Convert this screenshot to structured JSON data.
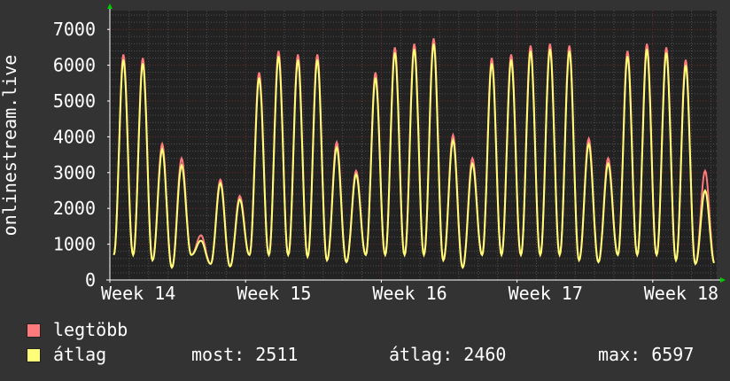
{
  "chart_data": {
    "type": "line",
    "ylabel": "onlinestream.live",
    "xlabel": "",
    "title": "",
    "ylim": [
      0,
      7500
    ],
    "yticks": [
      0,
      1000,
      2000,
      3000,
      4000,
      5000,
      6000,
      7000
    ],
    "xticks": [
      "Week 14",
      "Week 15",
      "Week 16",
      "Week 17",
      "Week 18"
    ],
    "x_range_days": [
      0,
      31.3
    ],
    "grid": true,
    "legend_position": "bottom-left",
    "colors": {
      "background": "#333333",
      "plot_background": "#222222",
      "grid_major": "#6b2c2c",
      "grid_minor": "#505050",
      "axis": "#ffffff",
      "arrow": "#00cc00",
      "max_line": "#ff7b7b",
      "avg_line": "#ffff77"
    },
    "series": [
      {
        "name": "legtöbb",
        "color": "#ff7b7b",
        "daily_peaks": [
          6300,
          6200,
          3800,
          3400,
          1250,
          2800,
          2350,
          5800,
          6400,
          6300,
          6300,
          3850,
          3050,
          5800,
          6500,
          6600,
          6750,
          4050,
          3400,
          6200,
          6300,
          6550,
          6600,
          6550,
          3950,
          3400,
          6400,
          6600,
          6500,
          6150,
          3050
        ],
        "daily_lows": [
          700,
          700,
          550,
          350,
          700,
          450,
          380,
          700,
          700,
          700,
          650,
          550,
          500,
          700,
          700,
          700,
          700,
          550,
          350,
          700,
          700,
          700,
          700,
          700,
          550,
          500,
          700,
          700,
          700,
          550,
          450
        ]
      },
      {
        "name": "átlag",
        "color": "#ffff77",
        "daily_peaks": [
          6150,
          6050,
          3650,
          3200,
          1100,
          2700,
          2250,
          5650,
          6250,
          6150,
          6150,
          3700,
          2950,
          5650,
          6350,
          6450,
          6600,
          3900,
          3250,
          6050,
          6150,
          6400,
          6450,
          6400,
          3800,
          3250,
          6250,
          6450,
          6350,
          6000,
          2500
        ],
        "daily_lows": [
          700,
          700,
          550,
          350,
          700,
          450,
          380,
          700,
          700,
          700,
          650,
          550,
          500,
          700,
          700,
          700,
          700,
          550,
          350,
          700,
          700,
          700,
          700,
          700,
          550,
          500,
          700,
          700,
          700,
          550,
          450
        ]
      }
    ],
    "legend": {
      "max_label": "legtöbb",
      "avg_label": "átlag",
      "stat_current": "most: 2511",
      "stat_average": "átlag: 2460",
      "stat_max": "max: 6597"
    }
  }
}
